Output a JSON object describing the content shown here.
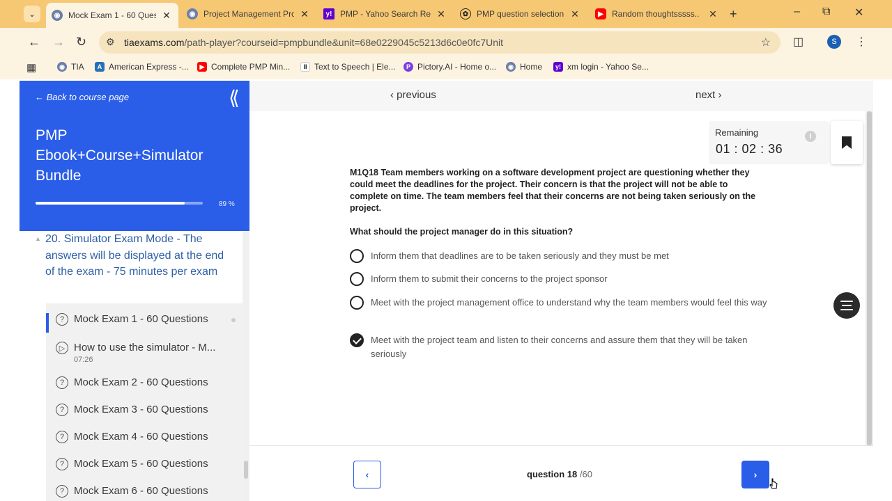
{
  "browser": {
    "tabs": [
      {
        "title": "Mock Exam 1 - 60 Questi",
        "favicon": "tia-shield-icon",
        "active": true
      },
      {
        "title": "Project Management Pro",
        "favicon": "tia-shield-icon",
        "active": false
      },
      {
        "title": "PMP - Yahoo Search Resu",
        "favicon": "yahoo-icon",
        "active": false
      },
      {
        "title": "PMP question selection",
        "favicon": "openai-icon",
        "active": false
      },
      {
        "title": "Random thoughtsssss..",
        "favicon": "youtube-icon",
        "active": false
      }
    ],
    "url_host": "tiaexams.com",
    "url_path": "/path-player?courseid=pmpbundle&unit=68e0229045c5213d6c0e0fc7Unit",
    "profile_initial": "S",
    "bookmarks": [
      {
        "label": "TIA",
        "icon": "tia-shield-icon"
      },
      {
        "label": "American Express -...",
        "icon": "amex-icon"
      },
      {
        "label": "Complete PMP Min...",
        "icon": "youtube-icon"
      },
      {
        "label": "Text to Speech | Ele...",
        "icon": "elevenlabs-icon"
      },
      {
        "label": "Pictory.AI - Home o...",
        "icon": "pictory-icon"
      },
      {
        "label": "Home",
        "icon": "tia-shield-icon"
      },
      {
        "label": "xm login - Yahoo Se...",
        "icon": "yahoo-icon"
      }
    ],
    "colors": {
      "frame": "#f7c873",
      "toolbar": "#fdf3e1"
    }
  },
  "sidebar": {
    "back_label": "Back to course page",
    "course_title": "PMP Ebook+Course+Simulator Bundle",
    "progress_percent": 89,
    "progress_label": "89 %",
    "section_title": "20. Simulator Exam Mode - The answers will be displayed at the end of the exam - 75 minutes per exam",
    "lessons": [
      {
        "label": "Mock Exam 1 - 60 Questions",
        "icon": "question-circle-icon",
        "active": true
      },
      {
        "label": "How to use the simulator - M...",
        "icon": "play-circle-icon",
        "duration": "07:26"
      },
      {
        "label": "Mock Exam 2 - 60 Questions",
        "icon": "question-circle-icon"
      },
      {
        "label": "Mock Exam 3 - 60 Questions",
        "icon": "question-circle-icon"
      },
      {
        "label": "Mock Exam 4 - 60 Questions",
        "icon": "question-circle-icon"
      },
      {
        "label": "Mock Exam 5 - 60 Questions",
        "icon": "question-circle-icon"
      },
      {
        "label": "Mock Exam 6 - 60 Questions",
        "icon": "question-circle-icon"
      }
    ],
    "accent_color": "#2a5de8"
  },
  "main": {
    "previous_label": "previous",
    "next_label": "next",
    "timer": {
      "label": "Remaining",
      "hours": "01",
      "minutes": "02",
      "seconds": "36"
    },
    "question_text": "M1Q18 Team members working on a software development project are questioning whether they could meet the deadlines for the project. Their concern is that the project will not be able to complete on time. The team members feel that their concerns are not being taken seriously on the project.",
    "question_ask": "What should the project manager do in this situation?",
    "options": [
      {
        "text": "Inform them that deadlines are to be taken seriously and they must be met",
        "selected": false
      },
      {
        "text": "Inform them to submit their concerns to the project sponsor",
        "selected": false
      },
      {
        "text": "Meet with the project management office to understand why the team members would feel this way",
        "selected": false
      },
      {
        "text": "Meet with the project team and listen to their concerns and assure them that they will be taken seriously",
        "selected": true
      }
    ],
    "question_number_label": "question 18",
    "question_total_label": "/60"
  }
}
